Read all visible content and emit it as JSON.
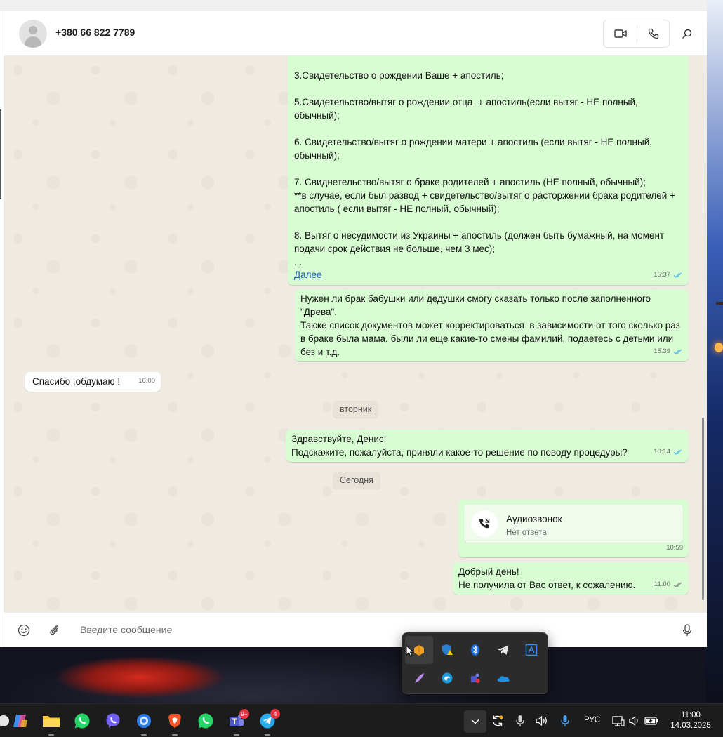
{
  "contact": {
    "name": "+380 66 822 7789"
  },
  "messages": [
    {
      "dir": "out",
      "text": "3.Свидетельство о рождении Ваше + апостиль;\n\n5.Свидетельство/вытяг о рождении отца  + апостиль(если вытяг - НЕ полный, обычный);\n\n6. Свидетельство/вытяг о рождении матери + апостиль (если вытяг - НЕ полный, обычный);\n\n7. Свиднетельство/вытяг о браке родителей + апостиль (НЕ полный, обычный);\n**в случае, если был развод + свидетельство/вытяг о расторжении брака родителей + апостиль ( если вытяг - НЕ полный, обычный);\n\n8. Вытяг о несудимости из Украины + апостиль (должен быть бумажный, на момент подачи срок действия не больше, чем 3 мес);\n...",
      "more": "Далее",
      "time": "15:37",
      "status": "read"
    },
    {
      "dir": "out",
      "text": "Нужен ли брак бабушки или дедушки смогу сказать только после заполненного \"Древа\".\nТакже список документов может корректироваться  в зависимости от того сколько раз в браке была мама, были ли еще какие-то смены фамилий, подаетесь с детьми или без и т.д.",
      "time": "15:39",
      "status": "read"
    },
    {
      "dir": "in",
      "text": "Спасибо ,обдумаю !",
      "time": "16:00"
    },
    {
      "dir": "out",
      "text": "Здравствуйте, Денис!\nПодскажите, пожалуйста, приняли какое-то решение по поводу процедуры?",
      "time": "10:14",
      "status": "read"
    },
    {
      "dir": "out",
      "type": "call",
      "title": "Аудиозвонок",
      "subtitle": "Нет ответа",
      "time": "10:59"
    },
    {
      "dir": "out",
      "text": "Добрый день!\nНе получила от Вас ответ, к сожалению.",
      "time": "11:00",
      "status": "delivered"
    }
  ],
  "dividers": {
    "tuesday": "вторник",
    "today": "Сегодня"
  },
  "composer": {
    "placeholder": "Введите сообщение"
  },
  "taskbar": {
    "apps": [
      {
        "name": "copilot-icon"
      },
      {
        "name": "file-explorer-icon"
      },
      {
        "name": "whatsapp-icon"
      },
      {
        "name": "viber-icon"
      },
      {
        "name": "browser-icon"
      },
      {
        "name": "brave-icon"
      },
      {
        "name": "whatsapp-icon"
      },
      {
        "name": "teams-icon",
        "badge": "9+"
      },
      {
        "name": "telegram-icon",
        "badge": "4"
      }
    ],
    "language": "РУС",
    "time": "11:00",
    "date": "14.03.2025"
  },
  "colors": {
    "outgoing": "#d9fdd3",
    "incoming": "#ffffff",
    "chat_bg": "#efeae2",
    "link": "#1a5fb4",
    "read_ticks": "#53bdeb",
    "badge": "#e3343f"
  }
}
